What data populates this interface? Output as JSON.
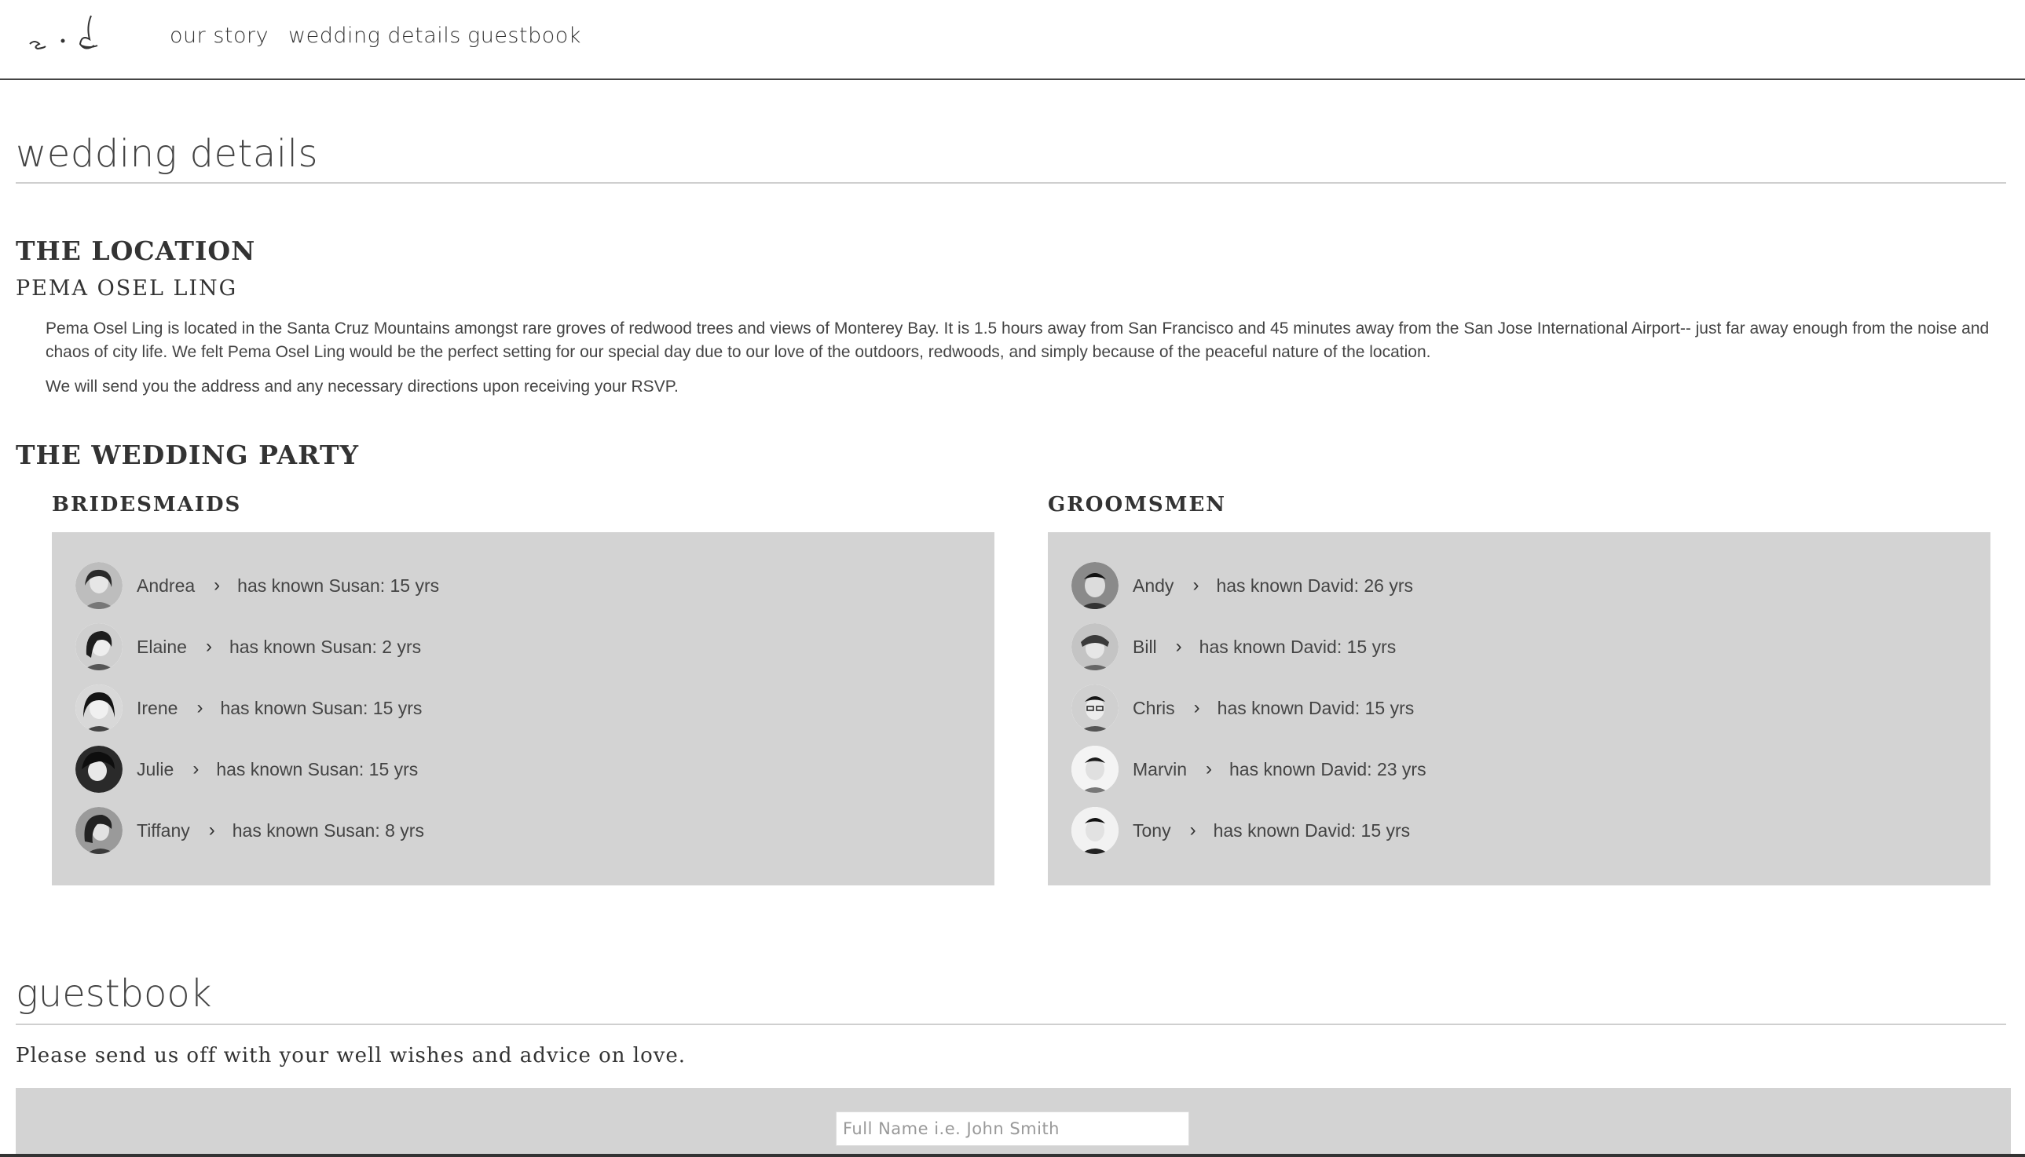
{
  "nav": {
    "logo_alt": "s + d",
    "links": [
      "our story",
      "wedding details",
      "guestbook"
    ]
  },
  "details": {
    "title": "wedding details",
    "location_heading": "THE LOCATION",
    "location_name": "PEMA OSEL LING",
    "location_paragraph_1": "Pema Osel Ling is located in the Santa Cruz Mountains amongst rare groves of redwood trees and views of Monterey Bay. It is 1.5 hours away from San Francisco and 45 minutes away from the San Jose International Airport-- just far away enough from the noise and chaos of city life. We felt Pema Osel Ling would be the perfect setting for our special day due to our love of the outdoors, redwoods, and simply because of the peaceful nature of the location.",
    "location_paragraph_2": "We will send you the address and any necessary directions upon receiving your RSVP.",
    "party_heading": "THE WEDDING PARTY"
  },
  "bridesmaids": {
    "title": "BRIDESMAIDS",
    "members": [
      {
        "name": "Andrea",
        "known": "has known Susan: 15 yrs"
      },
      {
        "name": "Elaine",
        "known": "has known Susan: 2 yrs"
      },
      {
        "name": "Irene",
        "known": "has known Susan: 15 yrs"
      },
      {
        "name": "Julie",
        "known": "has known Susan: 15 yrs"
      },
      {
        "name": "Tiffany",
        "known": "has known Susan: 8 yrs"
      }
    ]
  },
  "groomsmen": {
    "title": "GROOMSMEN",
    "members": [
      {
        "name": "Andy",
        "known": "has known David: 26 yrs"
      },
      {
        "name": "Bill",
        "known": "has known David: 15 yrs"
      },
      {
        "name": "Chris",
        "known": "has known David: 15 yrs"
      },
      {
        "name": "Marvin",
        "known": "has known David: 23 yrs"
      },
      {
        "name": "Tony",
        "known": "has known David: 15 yrs"
      }
    ]
  },
  "guestbook": {
    "title": "guestbook",
    "subtitle": "Please send us off with your well wishes and advice on love.",
    "name_placeholder": "Full Name i.e. John Smith"
  },
  "colors": {
    "panel_bg": "#d3d3d3",
    "text": "#333333",
    "rule": "#cfcfcf"
  }
}
